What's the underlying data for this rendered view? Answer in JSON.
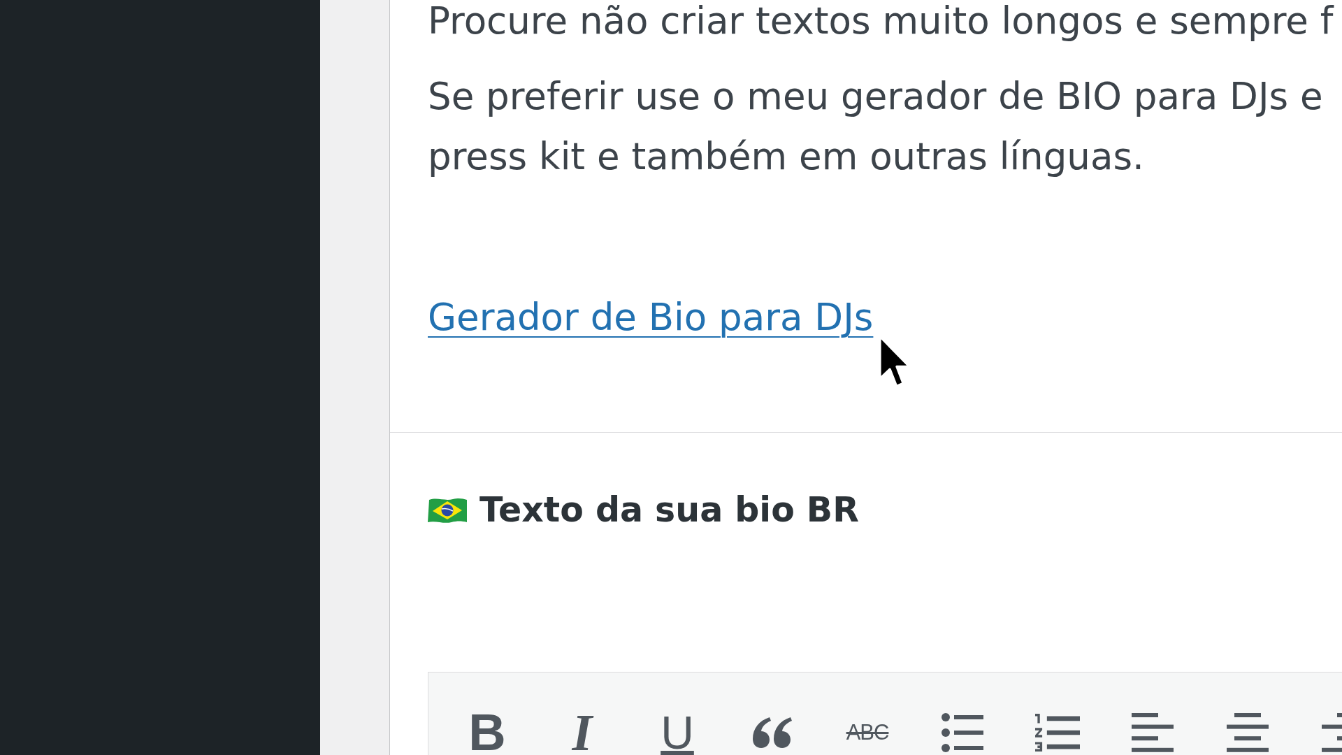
{
  "content": {
    "paragraphs": [
      {
        "lines": [
          "Procure não criar textos muito longos e sempre f"
        ]
      },
      {
        "lines": [
          "Se preferir use o meu gerador de BIO para DJs e",
          "press kit e também em outras línguas."
        ]
      }
    ],
    "link": {
      "label": "Gerador de Bio para DJs"
    }
  },
  "section": {
    "heading": "Texto da sua bio BR"
  },
  "toolbar": {
    "buttons": [
      {
        "kind": "bold",
        "glyph": "B"
      },
      {
        "kind": "italic",
        "glyph": "I"
      },
      {
        "kind": "underline",
        "glyph": "U"
      },
      {
        "kind": "blockquote"
      },
      {
        "kind": "strikethrough",
        "glyph": "ABC"
      },
      {
        "kind": "bullet_list"
      },
      {
        "kind": "numbered_list"
      },
      {
        "kind": "align_left"
      },
      {
        "kind": "align_center"
      },
      {
        "kind": "align_right"
      }
    ]
  }
}
